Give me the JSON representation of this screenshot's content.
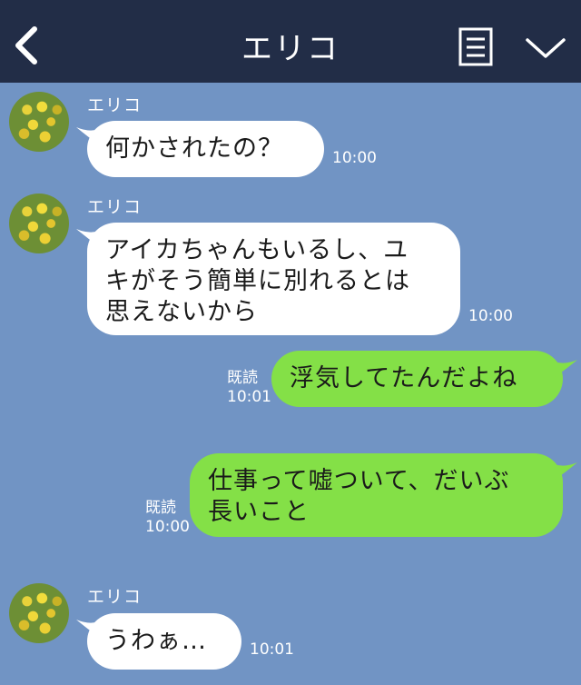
{
  "header": {
    "title": "エリコ",
    "back_icon": "chevron-left-icon",
    "menu_icon": "note-list-icon",
    "collapse_icon": "chevron-down-icon",
    "background_color": "#222d47"
  },
  "chat": {
    "background_color": "#7194c4",
    "incoming_bubble_color": "#ffffff",
    "outgoing_bubble_color": "#84e047"
  },
  "messages": [
    {
      "sender": "エリコ",
      "text": "何かされたの？",
      "time": "10:00"
    },
    {
      "sender": "エリコ",
      "line1": "アイカちゃんもいるし、ユ",
      "line2": "キがそう簡単に別れるとは",
      "line3": "思えないから",
      "time": "10:00"
    },
    {
      "read": "既読",
      "text": "浮気してたんだよね",
      "time": "10:01"
    },
    {
      "read": "既読",
      "line1": "仕事って嘘ついて、だいぶ",
      "line2": "長いこと",
      "time": "10:00"
    },
    {
      "sender": "エリコ",
      "text": "うわぁ…",
      "time": "10:01"
    }
  ]
}
